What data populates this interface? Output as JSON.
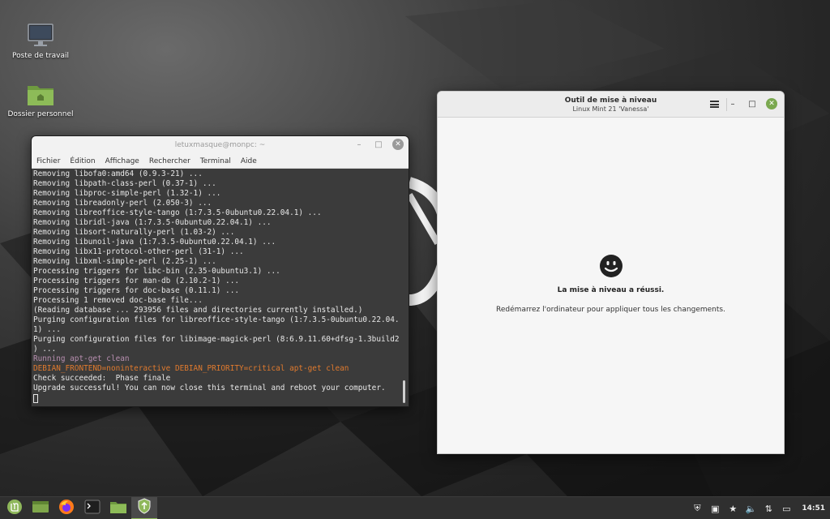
{
  "desktop": {
    "icons": [
      {
        "label": "Poste de travail",
        "icon": "computer-icon"
      },
      {
        "label": "Dossier personnel",
        "icon": "home-folder-icon"
      }
    ]
  },
  "terminal": {
    "title": "letuxmasque@monpc: ~",
    "menu": [
      "Fichier",
      "Édition",
      "Affichage",
      "Rechercher",
      "Terminal",
      "Aide"
    ],
    "lines": [
      {
        "text": "Removing libofa0:amd64 (0.9.3-21) ...",
        "color": "default"
      },
      {
        "text": "Removing libpath-class-perl (0.37-1) ...",
        "color": "default"
      },
      {
        "text": "Removing libproc-simple-perl (1.32-1) ...",
        "color": "default"
      },
      {
        "text": "Removing libreadonly-perl (2.050-3) ...",
        "color": "default"
      },
      {
        "text": "Removing libreoffice-style-tango (1:7.3.5-0ubuntu0.22.04.1) ...",
        "color": "default"
      },
      {
        "text": "Removing libridl-java (1:7.3.5-0ubuntu0.22.04.1) ...",
        "color": "default"
      },
      {
        "text": "Removing libsort-naturally-perl (1.03-2) ...",
        "color": "default"
      },
      {
        "text": "Removing libunoil-java (1:7.3.5-0ubuntu0.22.04.1) ...",
        "color": "default"
      },
      {
        "text": "Removing libx11-protocol-other-perl (31-1) ...",
        "color": "default"
      },
      {
        "text": "Removing libxml-simple-perl (2.25-1) ...",
        "color": "default"
      },
      {
        "text": "Processing triggers for libc-bin (2.35-0ubuntu3.1) ...",
        "color": "default"
      },
      {
        "text": "Processing triggers for man-db (2.10.2-1) ...",
        "color": "default"
      },
      {
        "text": "Processing triggers for doc-base (0.11.1) ...",
        "color": "default"
      },
      {
        "text": "Processing 1 removed doc-base file...",
        "color": "default"
      },
      {
        "text": "(Reading database ... 293956 files and directories currently installed.)",
        "color": "default"
      },
      {
        "text": "Purging configuration files for libreoffice-style-tango (1:7.3.5-0ubuntu0.22.04.",
        "color": "default"
      },
      {
        "text": "1) ...",
        "color": "default"
      },
      {
        "text": "Purging configuration files for libimage-magick-perl (8:6.9.11.60+dfsg-1.3build2",
        "color": "default"
      },
      {
        "text": ") ...",
        "color": "default"
      },
      {
        "text": "Running apt-get clean",
        "color": "purple"
      },
      {
        "text": "DEBIAN_FRONTEND=noninteractive DEBIAN_PRIORITY=critical apt-get clean",
        "color": "orange"
      },
      {
        "text": "Check succeeded:  Phase finale",
        "color": "default"
      },
      {
        "text": "Upgrade successful! You can now close this terminal and reboot your computer.",
        "color": "default"
      }
    ]
  },
  "updater": {
    "title": "Outil de mise à niveau",
    "subtitle": "Linux Mint 21 'Vanessa'",
    "message": "La mise à niveau a réussi.",
    "detail": "Redémarrez l'ordinateur pour appliquer tous les changements."
  },
  "taskbar": {
    "items": [
      {
        "name": "menu-button",
        "icon": "mint-menu-icon"
      },
      {
        "name": "show-desktop",
        "icon": "desktop-icon"
      },
      {
        "name": "firefox",
        "icon": "firefox-icon"
      },
      {
        "name": "terminal",
        "icon": "terminal-icon"
      },
      {
        "name": "files",
        "icon": "folder-icon"
      },
      {
        "name": "upgrade-tool",
        "icon": "upgrade-shield-icon"
      }
    ],
    "clock": "14:51",
    "accent": "#8fb85b"
  }
}
